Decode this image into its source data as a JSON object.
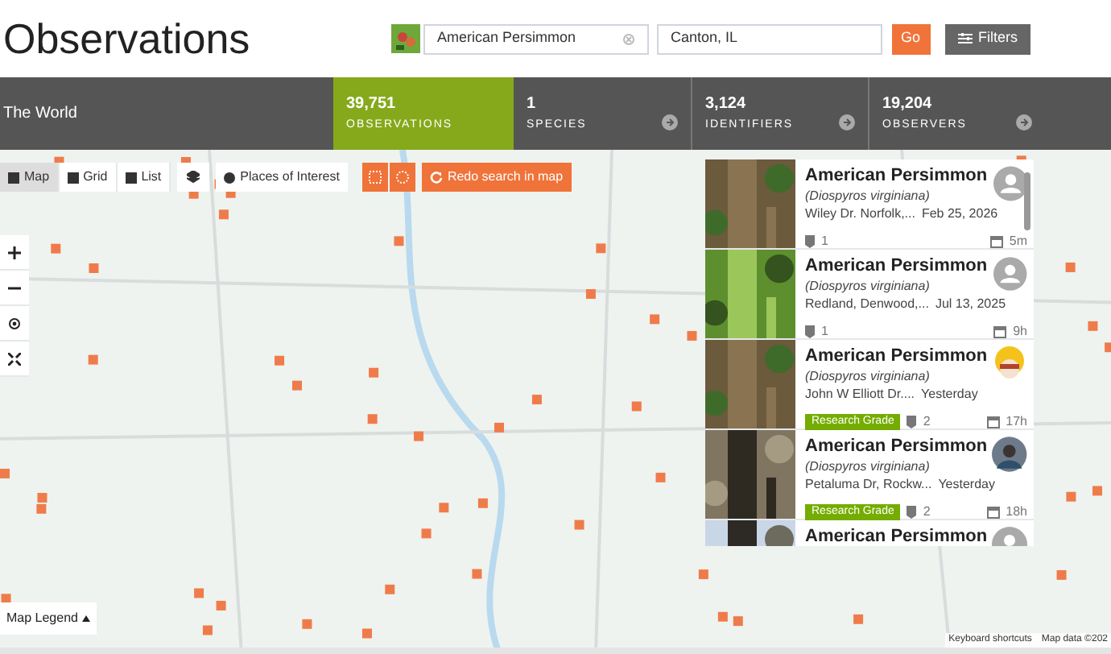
{
  "header": {
    "title": "Observations",
    "taxon_field": {
      "value": "American Persimmon"
    },
    "place_field": {
      "value": "Canton, IL"
    },
    "go": "Go",
    "filters": "Filters"
  },
  "stats": {
    "place": "The World",
    "items": [
      {
        "count": "39,751",
        "label": "OBSERVATIONS",
        "selected": true
      },
      {
        "count": "1",
        "label": "SPECIES",
        "selected": false
      },
      {
        "count": "3,124",
        "label": "IDENTIFIERS",
        "selected": false
      },
      {
        "count": "19,204",
        "label": "OBSERVERS",
        "selected": false
      }
    ]
  },
  "map_controls": {
    "views": [
      {
        "label": "Map",
        "selected": true
      },
      {
        "label": "Grid",
        "selected": false
      },
      {
        "label": "List",
        "selected": false
      }
    ],
    "places": "Places of Interest",
    "redo": "Redo search in map",
    "legend": "Map Legend",
    "attribution": [
      "Keyboard shortcuts",
      "Map data ©202"
    ]
  },
  "observations": [
    {
      "name": "American Persimmon",
      "scientific": "(Diospyros virginiana)",
      "place": "Wiley Dr. Norfolk,...",
      "date": "Feb 25, 2026",
      "ids": "1",
      "age": "5m",
      "kind": "default"
    },
    {
      "name": "American Persimmon",
      "scientific": "(Diospyros virginiana)",
      "place": "Redland, Denwood,...",
      "date": "Jul 13, 2025",
      "ids": "1",
      "age": "9h",
      "kind": "default"
    },
    {
      "name": "American Persimmon",
      "scientific": "(Diospyros virginiana)",
      "place": "John W Elliott Dr....",
      "date": "Yesterday",
      "grade": "Research Grade",
      "ids": "2",
      "age": "17h",
      "kind": "cartoon"
    },
    {
      "name": "American Persimmon",
      "scientific": "(Diospyros virginiana)",
      "place": "Petaluma Dr, Rockw...",
      "date": "Yesterday",
      "grade": "Research Grade",
      "ids": "2",
      "age": "18h"
    },
    {
      "name": "American Persimmon",
      "kind": "default"
    }
  ]
}
